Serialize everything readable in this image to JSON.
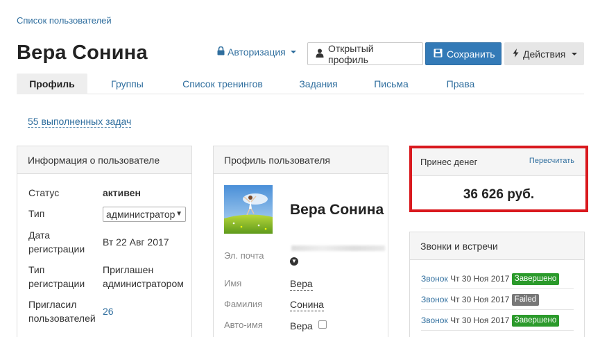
{
  "breadcrumb": "Список пользователей",
  "header": {
    "title": "Вера Сонина",
    "auth_label": "Авторизация",
    "open_profile_label": "Открытый профиль",
    "save_label": "Сохранить",
    "actions_label": "Действия"
  },
  "tabs": [
    "Профиль",
    "Группы",
    "Список тренингов",
    "Задания",
    "Письма",
    "Права"
  ],
  "active_tab": "Профиль",
  "tasks_link": "55 выполненных задач",
  "info": {
    "title": "Информация о пользователе",
    "status_label": "Статус",
    "status_value": "активен",
    "type_label": "Тип",
    "type_value": "администратор",
    "reg_date_label_1": "Дата",
    "reg_date_label_2": "регистрации",
    "reg_date_value": "Вт 22 Авг 2017",
    "reg_type_label_1": "Тип",
    "reg_type_label_2": "регистрации",
    "reg_type_value_1": "Приглашен",
    "reg_type_value_2": "администратором",
    "invited_label_1": "Пригласил",
    "invited_label_2": "пользователей",
    "invited_value": "26"
  },
  "profile": {
    "title": "Профиль пользователя",
    "name": "Вера Сонина",
    "email_label": "Эл. почта",
    "first_name_label": "Имя",
    "first_name_value": "Вера",
    "last_name_label": "Фамилия",
    "last_name_value": "Сонина",
    "auto_name_label": "Авто-имя",
    "auto_name_value": "Вера"
  },
  "money": {
    "title": "Принес денег",
    "recalc_label": "Пересчитать",
    "value": "36 626 руб."
  },
  "calls": {
    "title": "Звонки и встречи",
    "items": [
      {
        "type": "Звонок",
        "date": "Чт 30 Ноя 2017",
        "status": "Завершено"
      },
      {
        "type": "Звонок",
        "date": "Чт 30 Ноя 2017",
        "status": "Failed"
      },
      {
        "type": "Звонок",
        "date": "Чт 30 Ноя 2017",
        "status": "Завершено"
      }
    ]
  },
  "colors": {
    "link": "#2f6e9e",
    "primary": "#337ab7",
    "highlight_border": "#d9191e",
    "badge_done": "#2b9a2b",
    "badge_failed": "#777777"
  },
  "icons": [
    "lock-icon",
    "user-icon",
    "floppy-disk-icon",
    "lightning-icon",
    "chevron-down-icon",
    "circle-chevron-down-icon"
  ]
}
